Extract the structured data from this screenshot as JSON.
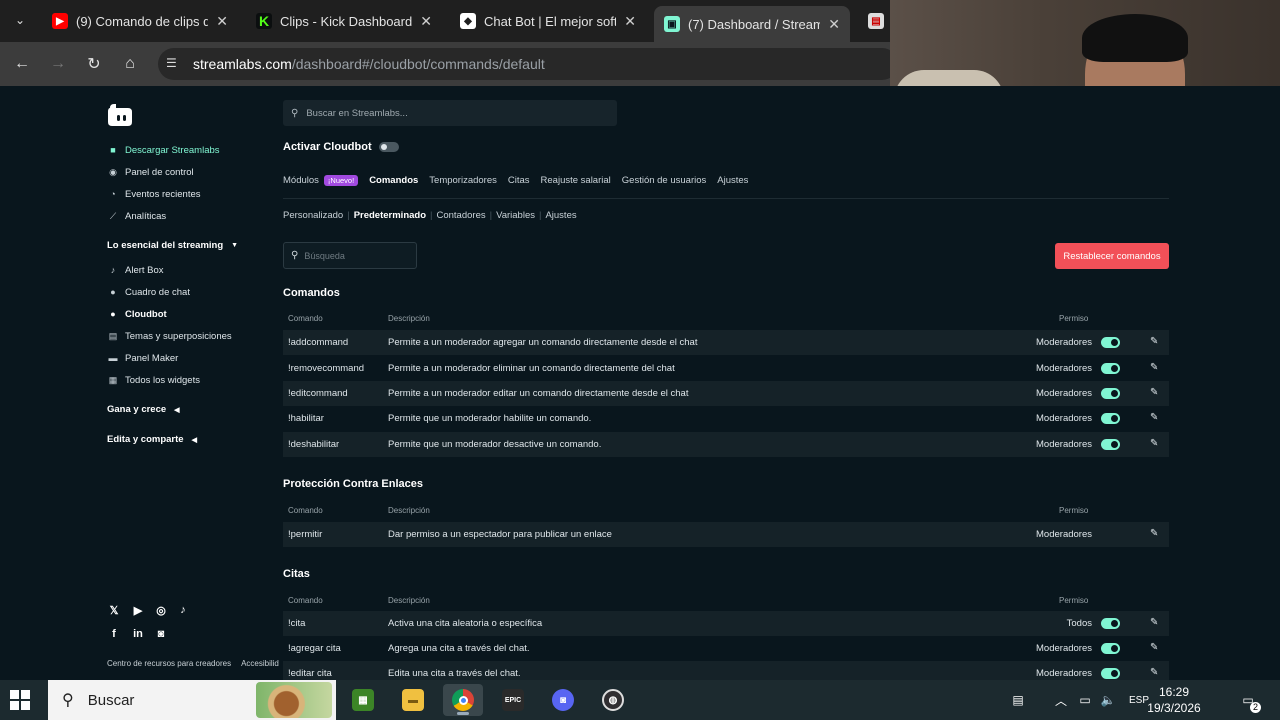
{
  "browser": {
    "tabs": [
      {
        "title": "(9) Comando de clips de",
        "favicon": "youtube-icon",
        "color": "#ff0000",
        "active": false
      },
      {
        "title": "Clips - Kick Dashboard",
        "favicon": "kick-icon",
        "color": "#53fc18",
        "active": false
      },
      {
        "title": "Chat Bot | El mejor softw",
        "favicon": "chatbot-icon",
        "color": "#ffffff",
        "active": false
      },
      {
        "title": "(7) Dashboard / Streamla",
        "favicon": "streamlabs-icon",
        "color": "#80f5d2",
        "active": true
      }
    ],
    "url_host": "streamlabs.com",
    "url_path": "/dashboard#/cloudbot/commands/default"
  },
  "sidebar": {
    "items": [
      {
        "label": "Descargar Streamlabs",
        "icon": "download-icon"
      },
      {
        "label": "Panel de control",
        "icon": "dashboard-icon"
      },
      {
        "label": "Eventos recientes",
        "icon": "clock-icon"
      },
      {
        "label": "Analíticas",
        "icon": "chart-icon"
      }
    ],
    "essentials_title": "Lo esencial del streaming",
    "essentials": [
      {
        "label": "Alert Box",
        "icon": "bell-icon"
      },
      {
        "label": "Cuadro de chat",
        "icon": "chat-icon"
      },
      {
        "label": "Cloudbot",
        "icon": "cloudbot-icon"
      },
      {
        "label": "Temas y superposiciones",
        "icon": "themes-icon"
      },
      {
        "label": "Panel Maker",
        "icon": "panel-icon"
      },
      {
        "label": "Todos los widgets",
        "icon": "grid-icon"
      }
    ],
    "grow_title": "Gana y crece",
    "edit_title": "Edita y comparte",
    "footer": {
      "resources": "Centro de recursos para creadores",
      "accessibility": "Accesibilid"
    }
  },
  "header": {
    "search_placeholder": "Buscar en Streamlabs..."
  },
  "cloudbot": {
    "activate_label": "Activar Cloudbot",
    "main_tabs": [
      "Módulos",
      "Comandos",
      "Temporizadores",
      "Citas",
      "Reajuste salarial",
      "Gestión de usuarios",
      "Ajustes"
    ],
    "new_badge": "¡Nuevo!",
    "sub_tabs": [
      "Personalizado",
      "Predeterminado",
      "Contadores",
      "Variables",
      "Ajustes"
    ],
    "filter_placeholder": "Búsqueda",
    "reset_button": "Restablecer comandos"
  },
  "columns": {
    "command": "Comando",
    "description": "Descripción",
    "permission": "Permiso"
  },
  "sections": [
    {
      "title": "Comandos",
      "rows": [
        {
          "command": "!addcommand",
          "description": "Permite a un moderador agregar un comando directamente desde el chat",
          "permission": "Moderadores",
          "toggle": true
        },
        {
          "command": "!removecommand",
          "description": "Permite a un moderador eliminar un comando directamente del chat",
          "permission": "Moderadores",
          "toggle": true
        },
        {
          "command": "!editcommand",
          "description": "Permite a un moderador editar un comando directamente desde el chat",
          "permission": "Moderadores",
          "toggle": true
        },
        {
          "command": "!habilitar",
          "description": "Permite que un moderador habilite un comando.",
          "permission": "Moderadores",
          "toggle": true
        },
        {
          "command": "!deshabilitar",
          "description": "Permite que un moderador desactive un comando.",
          "permission": "Moderadores",
          "toggle": true
        }
      ]
    },
    {
      "title": "Protección Contra Enlaces",
      "rows": [
        {
          "command": "!permitir",
          "description": "Dar permiso a un espectador para publicar un enlace",
          "permission": "Moderadores",
          "toggle": false
        }
      ]
    },
    {
      "title": "Citas",
      "rows": [
        {
          "command": "!cita",
          "description": "Activa una cita aleatoria o específica",
          "permission": "Todos",
          "toggle": true
        },
        {
          "command": "!agregar cita",
          "description": "Agrega una cita a través del chat.",
          "permission": "Moderadores",
          "toggle": true
        },
        {
          "command": "!editar cita",
          "description": "Edita una cita a través del chat.",
          "permission": "Moderadores",
          "toggle": true
        }
      ]
    }
  ],
  "taskbar": {
    "search_placeholder": "Buscar",
    "language": "ESP",
    "time": "16:29",
    "date": "19/3/2026",
    "notifications": "2"
  },
  "colors": {
    "accent": "#80f5d2",
    "danger": "#f25058",
    "background": "#09161d"
  }
}
